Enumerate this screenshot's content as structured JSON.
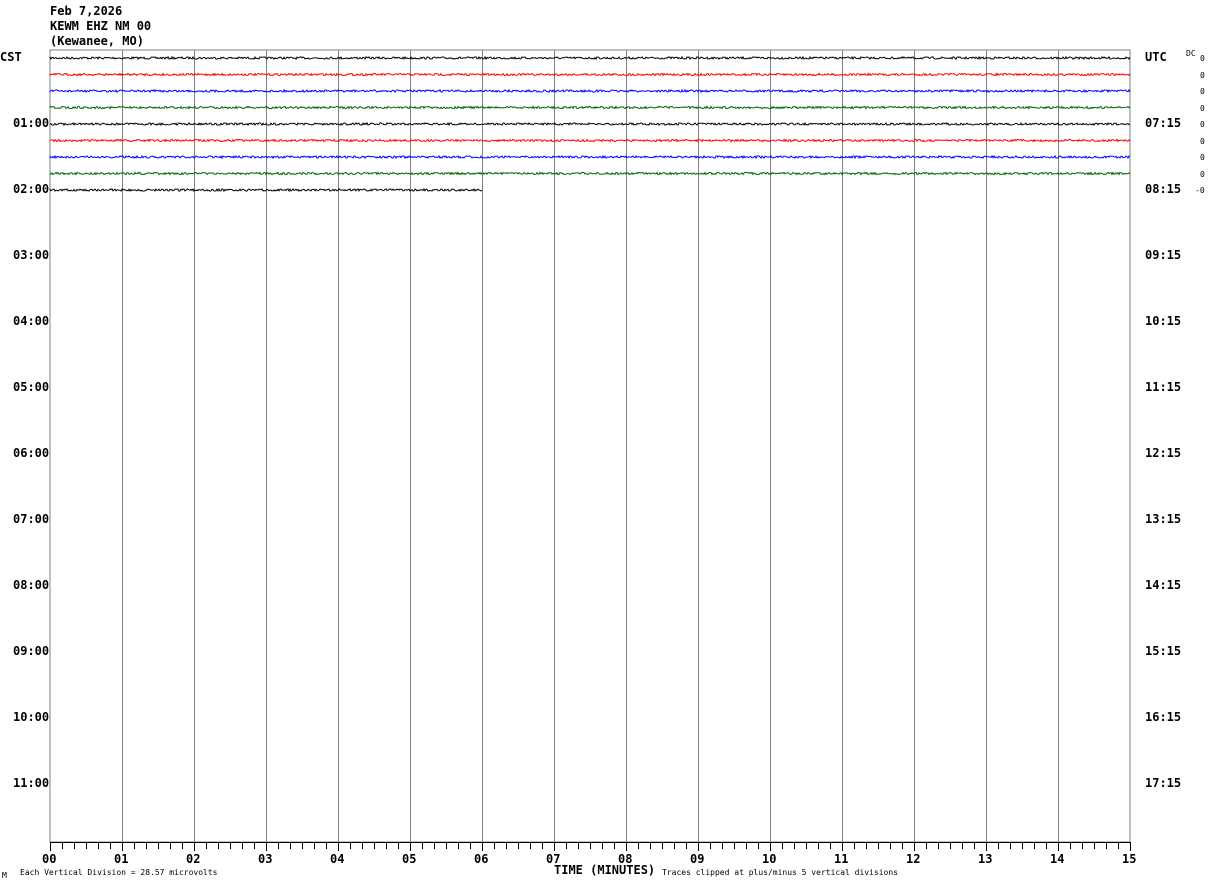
{
  "header": {
    "date": "Feb 7,2026",
    "station": "KEWM EHZ NM 00",
    "location": "(Kewanee, MO)"
  },
  "left_zone": "CST",
  "right_zone": "UTC",
  "dc_label": "DC",
  "footer": {
    "scale_text": "Each Vertical Division =    28.57 microvolts",
    "xlabel": "TIME (MINUTES)",
    "clip_text": "Traces clipped at plus/minus 5 vertical divisions",
    "corner_mark": "M"
  },
  "chart_data": {
    "type": "line",
    "title": "",
    "xlabel": "TIME (MINUTES)",
    "xlim": [
      0,
      15
    ],
    "x_ticks": [
      "00",
      "01",
      "02",
      "03",
      "04",
      "05",
      "06",
      "07",
      "08",
      "09",
      "10",
      "11",
      "12",
      "13",
      "14",
      "15"
    ],
    "rows_per_hour": 4,
    "left_hour_labels": [
      "CST",
      "01:00",
      "02:00",
      "03:00",
      "04:00",
      "05:00",
      "06:00",
      "07:00",
      "08:00",
      "09:00",
      "10:00",
      "11:00"
    ],
    "right_hour_labels": [
      "UTC",
      "07:15",
      "08:15",
      "09:15",
      "10:15",
      "11:15",
      "12:15",
      "13:15",
      "14:15",
      "15:15",
      "16:15",
      "17:15"
    ],
    "trace_colors": [
      "#000000",
      "#ff0000",
      "#0000ff",
      "#006400"
    ],
    "traces": [
      {
        "row": 0,
        "end_minute": 15,
        "dc": "0"
      },
      {
        "row": 1,
        "end_minute": 15,
        "dc": "0"
      },
      {
        "row": 2,
        "end_minute": 15,
        "dc": "0"
      },
      {
        "row": 3,
        "end_minute": 15,
        "dc": "0"
      },
      {
        "row": 4,
        "end_minute": 15,
        "dc": "0"
      },
      {
        "row": 5,
        "end_minute": 15,
        "dc": "0"
      },
      {
        "row": 6,
        "end_minute": 15,
        "dc": "0"
      },
      {
        "row": 7,
        "end_minute": 15,
        "dc": "0"
      },
      {
        "row": 8,
        "end_minute": 6,
        "dc": "-0"
      }
    ],
    "grid": true
  }
}
